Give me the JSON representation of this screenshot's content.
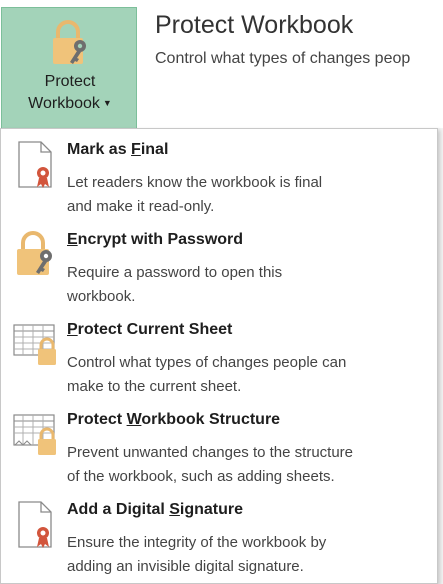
{
  "header": {
    "button_line1": "Protect",
    "button_line2": "Workbook",
    "title": "Protect Workbook",
    "description": "Control what types of changes peop"
  },
  "menu": {
    "items": [
      {
        "title_pre": "Mark as ",
        "title_key": "F",
        "title_post": "inal",
        "desc1": "Let readers know the workbook is final",
        "desc2": "and make it read-only.",
        "icon": "mark-final-icon"
      },
      {
        "title_pre": "",
        "title_key": "E",
        "title_post": "ncrypt with Password",
        "desc1": "Require a password to open this",
        "desc2": "workbook.",
        "icon": "lock-key-icon"
      },
      {
        "title_pre": "",
        "title_key": "P",
        "title_post": "rotect Current Sheet",
        "desc1": "Control what types of changes people can",
        "desc2": "make to the current sheet.",
        "icon": "sheet-lock-icon"
      },
      {
        "title_pre": "Protect ",
        "title_key": "W",
        "title_post": "orkbook Structure",
        "desc1": "Prevent unwanted changes to the structure",
        "desc2": "of the workbook, such as adding sheets.",
        "icon": "workbook-lock-icon"
      },
      {
        "title_pre": "Add a Digital ",
        "title_key": "S",
        "title_post": "ignature",
        "desc1": "Ensure the integrity of the workbook by",
        "desc2": "adding an invisible digital signature.",
        "icon": "signature-ribbon-icon"
      }
    ]
  }
}
